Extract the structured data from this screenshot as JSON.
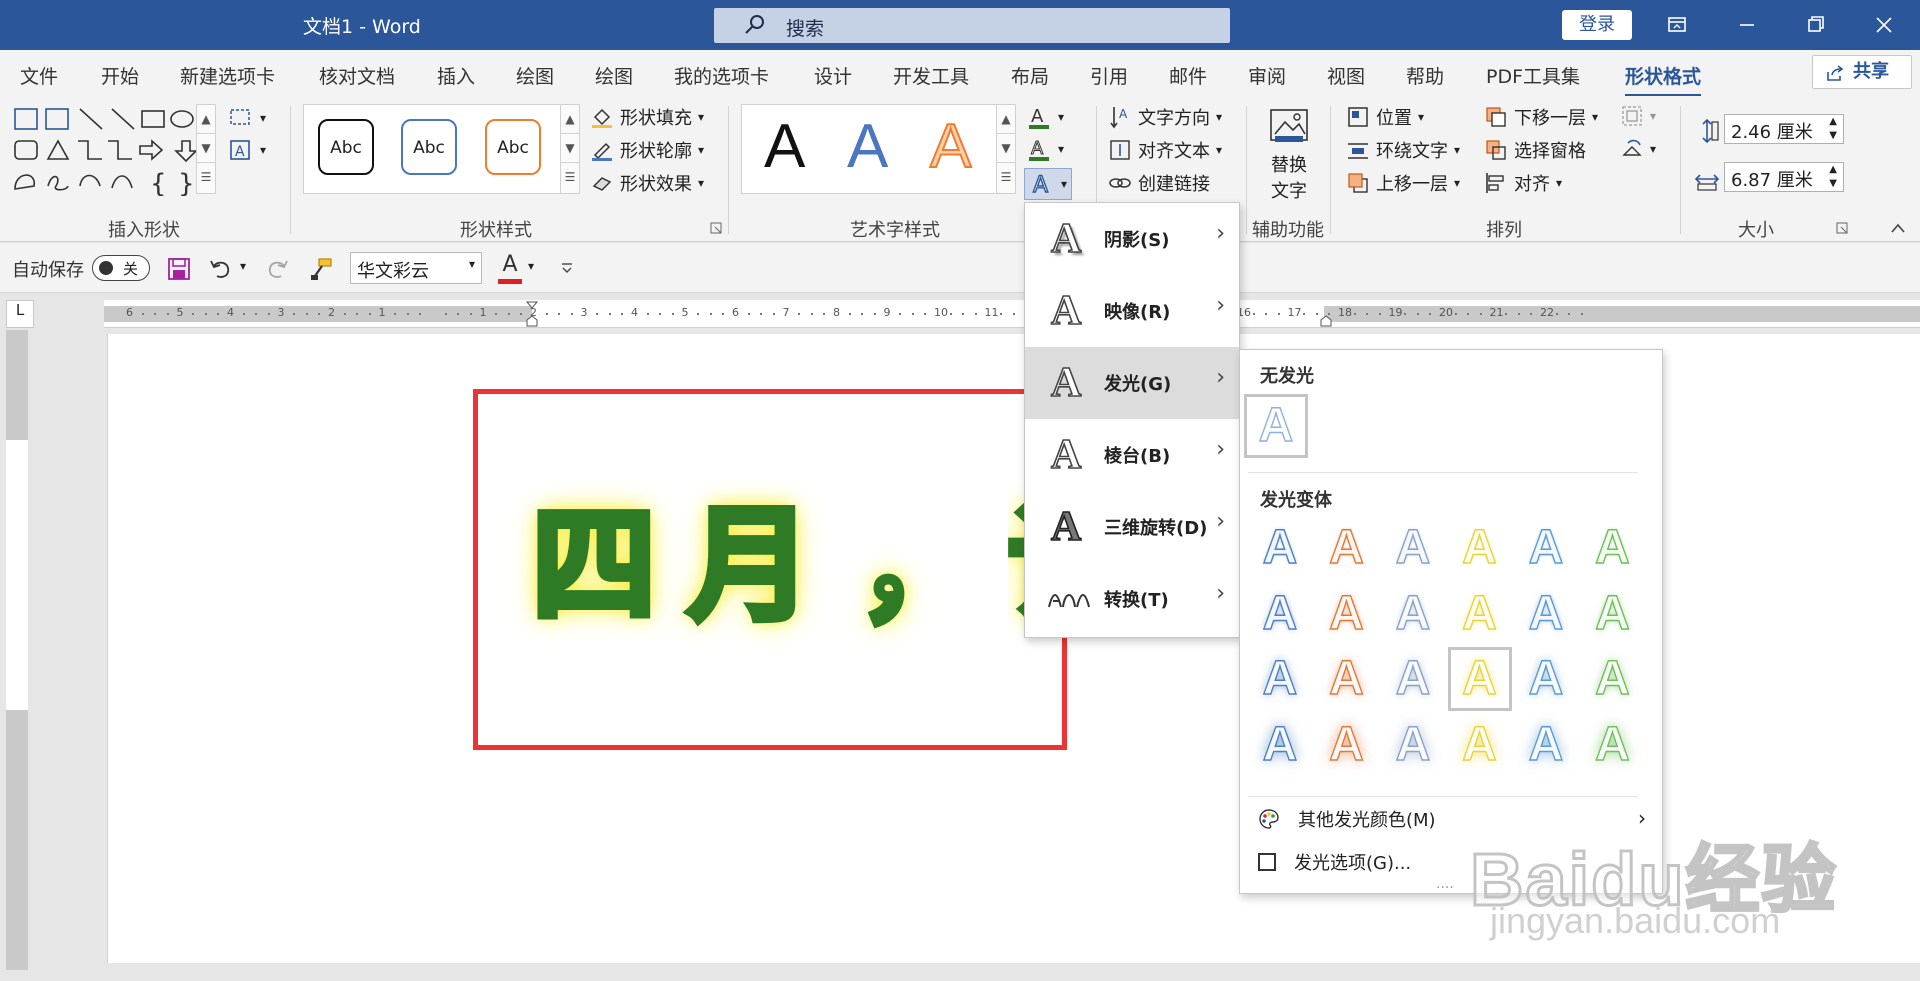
{
  "window": {
    "title": "文档1  -  Word",
    "search_placeholder": "搜索",
    "login_label": "登录"
  },
  "tabs": [
    {
      "label": "文件"
    },
    {
      "label": "开始"
    },
    {
      "label": "新建选项卡"
    },
    {
      "label": "核对文档"
    },
    {
      "label": "插入"
    },
    {
      "label": "绘图"
    },
    {
      "label": "绘图"
    },
    {
      "label": "我的选项卡"
    },
    {
      "label": "设计"
    },
    {
      "label": "开发工具"
    },
    {
      "label": "布局"
    },
    {
      "label": "引用"
    },
    {
      "label": "邮件"
    },
    {
      "label": "审阅"
    },
    {
      "label": "视图"
    },
    {
      "label": "帮助"
    },
    {
      "label": "PDF工具集"
    },
    {
      "label": "形状格式"
    }
  ],
  "share_label": "共享",
  "ribbon": {
    "groups": {
      "insert_shapes": "插入形状",
      "shape_styles": "形状样式",
      "art_styles": "艺术字样式",
      "accessibility": "辅助功能",
      "arrange": "排列",
      "size": "大小"
    },
    "shape_style_samples": [
      "Abc",
      "Abc",
      "Abc"
    ],
    "art_samples": [
      "A",
      "A",
      "A"
    ],
    "shape_fill": "形状填充",
    "shape_outline": "形状轮廓",
    "shape_effects": "形状效果",
    "text_direction": "文字方向",
    "align_text": "对齐文本",
    "create_link": "创建链接",
    "alt_text_line1": "替换",
    "alt_text_line2": "文字",
    "position": "位置",
    "wrap_text": "环绕文字",
    "bring_forward": "上移一层",
    "send_backward": "下移一层",
    "selection_pane": "选择窗格",
    "align": "对齐",
    "height": "2.46 厘米",
    "width": "6.87 厘米"
  },
  "qat": {
    "autosave_label": "自动保存",
    "autosave_state": "关",
    "font_name": "华文彩云",
    "font_color_letter": "A"
  },
  "ruler": {
    "corner": "L",
    "numbers": [
      "6",
      "5",
      "4",
      "3",
      "2",
      "1",
      "",
      "1",
      "2",
      "3",
      "4",
      "5",
      "6",
      "7",
      "8",
      "9",
      "10",
      "11",
      "12",
      "13",
      "14",
      "15",
      "16",
      "17",
      "18",
      "19",
      "20",
      "21",
      "22"
    ]
  },
  "document": {
    "text_parts": [
      "四",
      "月",
      "，",
      "诗"
    ]
  },
  "effects_menu": {
    "items": [
      {
        "label": "阴影(S)"
      },
      {
        "label": "映像(R)"
      },
      {
        "label": "发光(G)"
      },
      {
        "label": "棱台(B)"
      },
      {
        "label": "三维旋转(D)"
      },
      {
        "label": "转换(T)"
      }
    ]
  },
  "glow_panel": {
    "no_glow_header": "无发光",
    "variants_header": "发光变体",
    "variant_colors": [
      "#4f81c7",
      "#e07a3c",
      "#8aa2c8",
      "#e7d43a",
      "#5b9bd5",
      "#6fbf5a"
    ],
    "more_colors": "其他发光颜色(M)",
    "glow_options": "发光选项(G)..."
  },
  "watermark": {
    "line1": "Baidu经验",
    "line2": "jingyan.baidu.com"
  },
  "colors": {
    "word_blue": "#2b579a",
    "text_outline": "#2f7b25",
    "text_glow": "#f7ef3b",
    "red_box": "#ee3333"
  }
}
